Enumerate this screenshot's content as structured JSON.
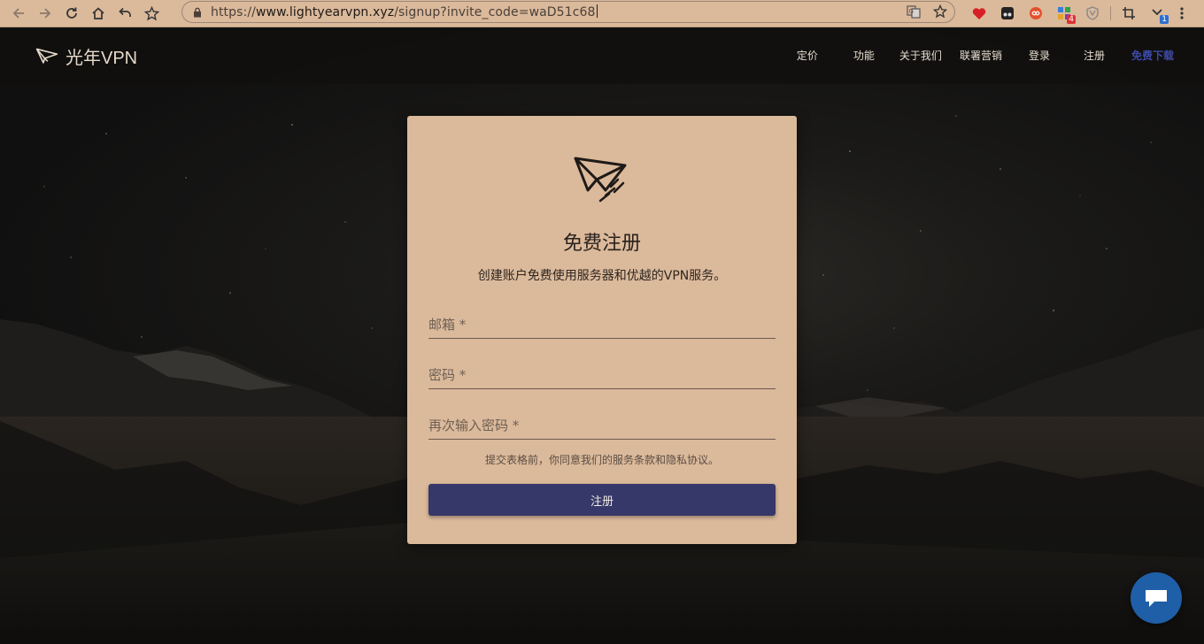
{
  "browser": {
    "url_prefix": "https://",
    "url_host": "www.lightyearvpn.xyz",
    "url_path": "/signup?invite_code=waD51c68",
    "extension_badges": {
      "ext_5": "4",
      "ext_8": "1"
    }
  },
  "header": {
    "logo_text": "光年VPN",
    "nav": [
      "定价",
      "功能",
      "关于我们",
      "联署营销",
      "登录",
      "注册"
    ],
    "nav_primary": "免费下载"
  },
  "signup": {
    "title": "免费注册",
    "subtitle": "创建账户免费使用服务器和优越的VPN服务。",
    "email_placeholder": "邮箱 *",
    "password_placeholder": "密码 *",
    "confirm_placeholder": "再次输入密码 *",
    "terms": "提交表格前，你同意我们的服务条款和隐私协议。",
    "submit_label": "注册"
  },
  "colors": {
    "card": "#dbb99b",
    "button": "#363869",
    "nav_primary": "#3f4aa6",
    "chat": "#1f5fa8",
    "chrome": "#dbb99b"
  }
}
